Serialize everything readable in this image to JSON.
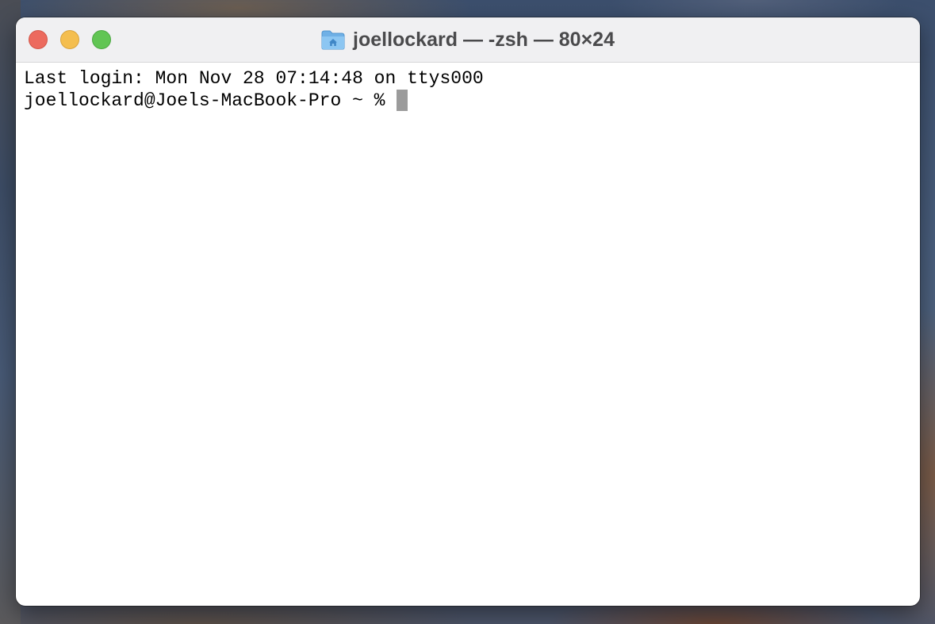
{
  "window": {
    "title": "joellockard — -zsh — 80×24",
    "title_icon": "home-folder-icon",
    "traffic_lights": {
      "close_color": "#ec6a5e",
      "minimize_color": "#f4be4f",
      "zoom_color": "#61c554"
    }
  },
  "terminal": {
    "lines": [
      "Last login: Mon Nov 28 07:14:48 on ttys000"
    ],
    "prompt": "joellockard@Joels-MacBook-Pro ~ % ",
    "cursor_color": "#9b9b9b"
  }
}
